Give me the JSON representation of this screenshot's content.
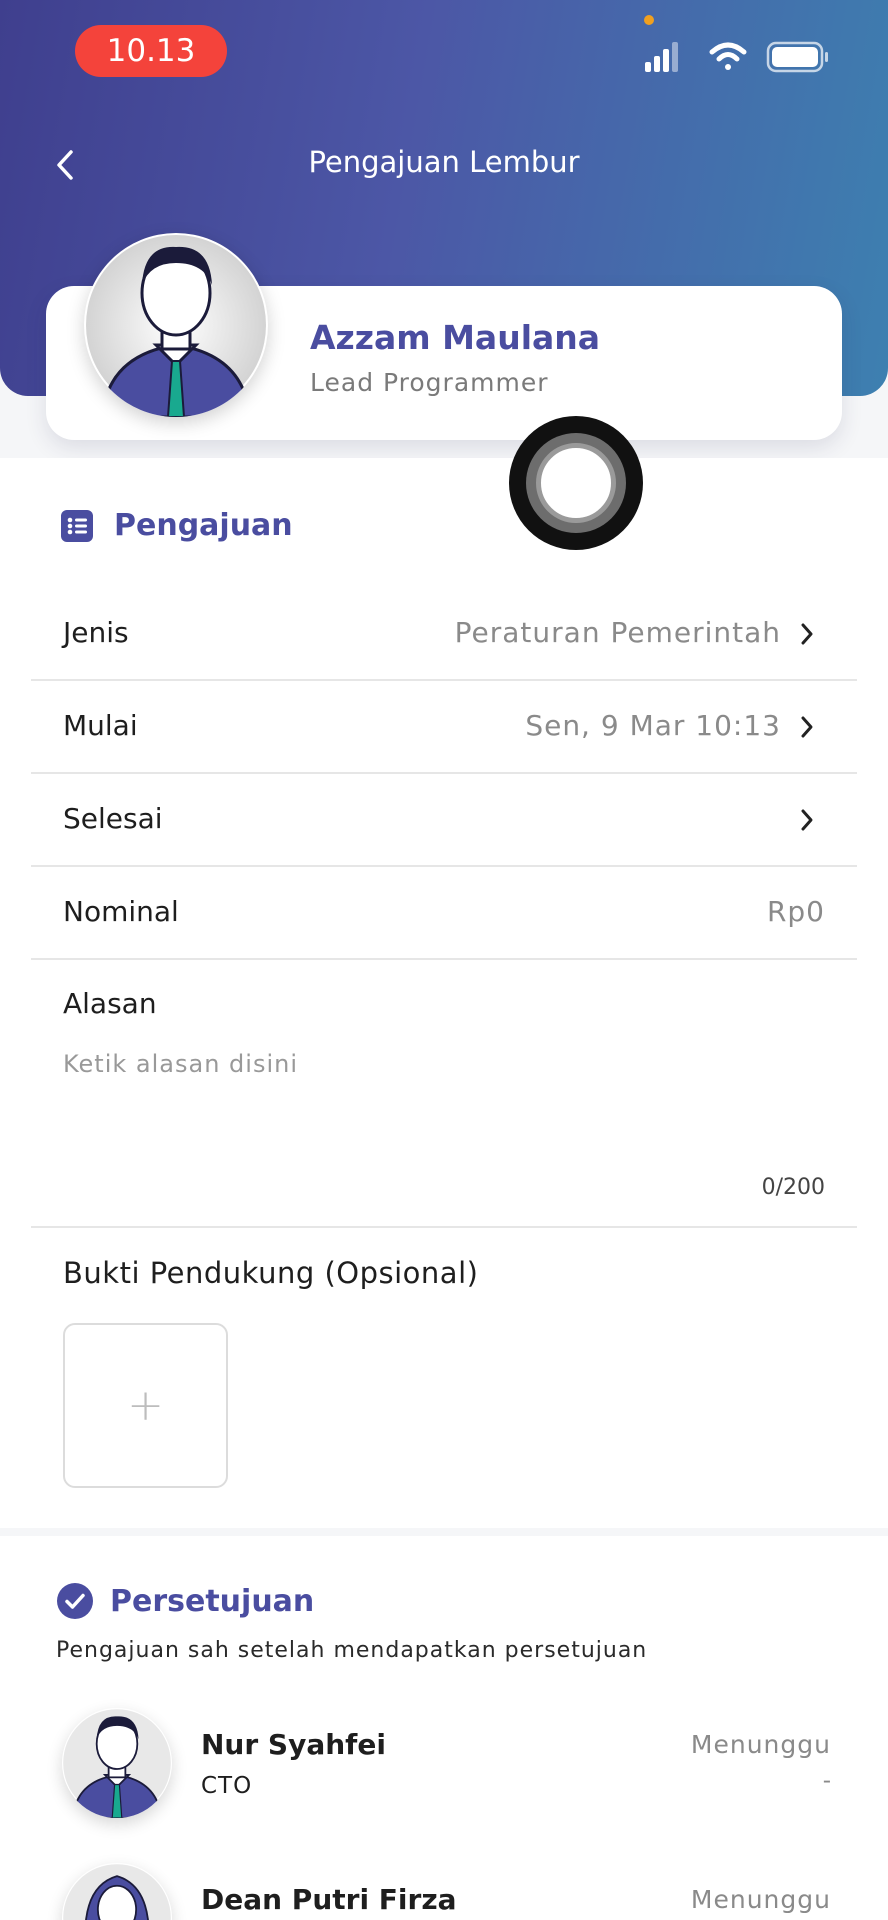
{
  "status_bar": {
    "time": "10.13"
  },
  "header": {
    "title": "Pengajuan Lembur"
  },
  "profile": {
    "name": "Azzam Maulana",
    "role": "Lead Programmer"
  },
  "form_section": {
    "title": "Pengajuan",
    "rows": [
      {
        "label": "Jenis",
        "value": "Peraturan Pemerintah"
      },
      {
        "label": "Mulai",
        "value": "Sen, 9 Mar 10:13"
      },
      {
        "label": "Selesai",
        "value": ""
      },
      {
        "label": "Nominal",
        "value": "Rp0"
      }
    ],
    "reason": {
      "label": "Alasan",
      "placeholder": "Ketik alasan disini",
      "value": "",
      "counter": "0/200"
    },
    "support": {
      "label": "Bukti Pendukung (Opsional)",
      "add_symbol": "+"
    }
  },
  "approval_section": {
    "title": "Persetujuan",
    "subtitle": "Pengajuan sah setelah mendapatkan persetujuan",
    "approvers": [
      {
        "name": "Nur Syahfei",
        "role": "CTO",
        "status": "Menunggu",
        "date": "-"
      },
      {
        "name": "Dean Putri Firza",
        "role": "",
        "status": "Menunggu",
        "date": ""
      }
    ]
  },
  "colors": {
    "accent": "#4a4da0",
    "header_start": "#3f3f8e",
    "header_end": "#3d80b0",
    "time_pill": "#f4433b"
  }
}
